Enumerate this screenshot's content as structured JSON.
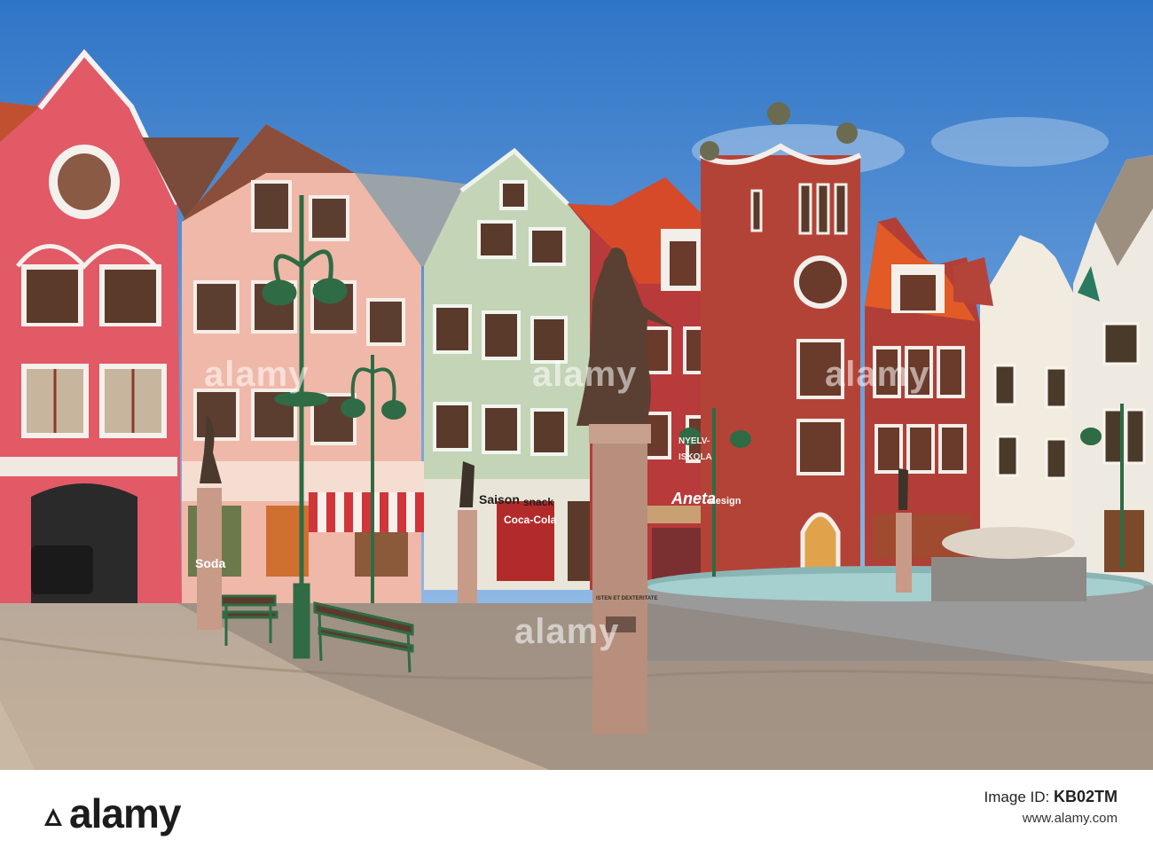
{
  "photo": {
    "description_signs": {
      "saison": "Saison",
      "snack": "snack",
      "cola": "Coca-Cola",
      "aneta": "Aneta",
      "design": "design",
      "iskola": "ISKOLA",
      "nyelv": "NYELV-",
      "soda": "Soda",
      "plaque": "ISTEN ET DEXTERITATE"
    },
    "watermarks": [
      "alamy",
      "alamy",
      "alamy",
      "alamy"
    ]
  },
  "footer": {
    "brand": "alamy",
    "caption_label": "Image ID:",
    "image_id": "KB02TM",
    "url": "www.alamy.com"
  }
}
